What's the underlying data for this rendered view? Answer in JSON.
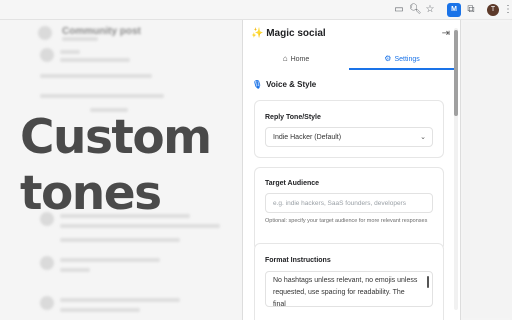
{
  "browser": {
    "icons": [
      "cast-icon",
      "zoom-icon",
      "star-icon"
    ],
    "extension_badge": "M",
    "profile_initial": "T"
  },
  "background_page": {
    "title": "Community post"
  },
  "headline": {
    "line1": "Custom",
    "line2": "tones"
  },
  "panel": {
    "title": "✨ Magic social",
    "tabs": [
      {
        "label": "Home",
        "icon": "home-icon"
      },
      {
        "label": "Settings",
        "icon": "gear-icon"
      }
    ],
    "active_tab": "Settings",
    "section_title": "Voice & Style",
    "reply_tone": {
      "label": "Reply Tone/Style",
      "value": "Indie Hacker (Default)"
    },
    "target_audience": {
      "label": "Target Audience",
      "placeholder": "e.g. indie hackers, SaaS founders, developers",
      "helper": "Optional: specify your target audience for more relevant responses"
    },
    "format_instructions": {
      "label": "Format Instructions",
      "value": "No hashtags unless relevant, no emojis unless requested, use spacing for readability. The final"
    }
  },
  "colors": {
    "accent": "#1a73e8",
    "headline": "#4a4a4a"
  }
}
